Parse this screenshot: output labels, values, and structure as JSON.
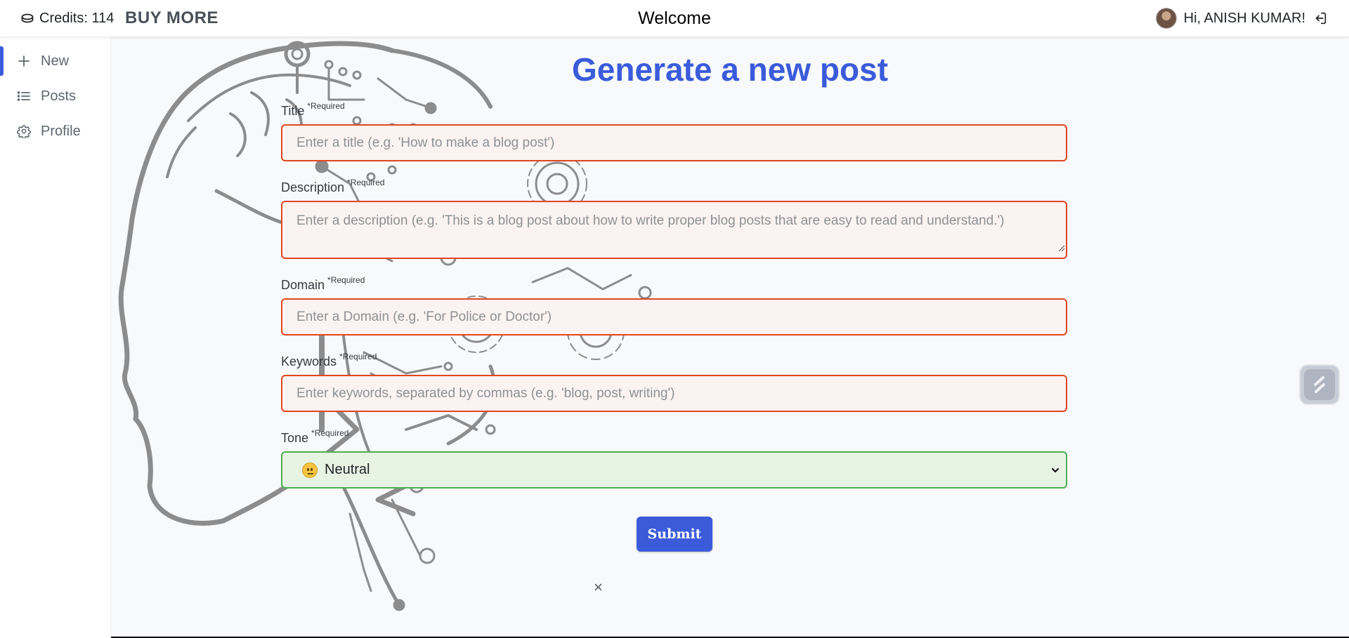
{
  "header": {
    "credits_label": "Credits: 114",
    "buy_more_label": "BUY MORE",
    "title": "Welcome",
    "greeting": "Hi, ANISH KUMAR!"
  },
  "sidebar": {
    "items": [
      {
        "label": "New",
        "icon": "plus-icon",
        "active": true
      },
      {
        "label": "Posts",
        "icon": "list-icon",
        "active": false
      },
      {
        "label": "Profile",
        "icon": "gear-icon",
        "active": false
      }
    ]
  },
  "form": {
    "heading": "Generate a new post",
    "required_marker": "*Required",
    "title": {
      "label": "Title",
      "value": "",
      "placeholder": "Enter a title (e.g. 'How to make a blog post')"
    },
    "description": {
      "label": "Description",
      "value": "",
      "placeholder": "Enter a description (e.g. 'This is a blog post about how to write proper blog posts that are easy to read and understand.')"
    },
    "domain": {
      "label": "Domain",
      "value": "",
      "placeholder": "Enter a Domain (e.g. 'For Police or Doctor')"
    },
    "keywords": {
      "label": "Keywords",
      "value": "",
      "placeholder": "Enter keywords, separated by commas (e.g. 'blog, post, writing')"
    },
    "tone": {
      "label": "Tone",
      "selected": "Neutral",
      "emoji": "neutral-face-icon"
    },
    "submit_label": "Submit",
    "close_symbol": "×"
  },
  "colors": {
    "accent": "#3b5bdb",
    "error_border": "#e0461f",
    "error_fill": "#fbf3f1",
    "success_border": "#4caf50",
    "success_fill": "#e7f4e4"
  }
}
